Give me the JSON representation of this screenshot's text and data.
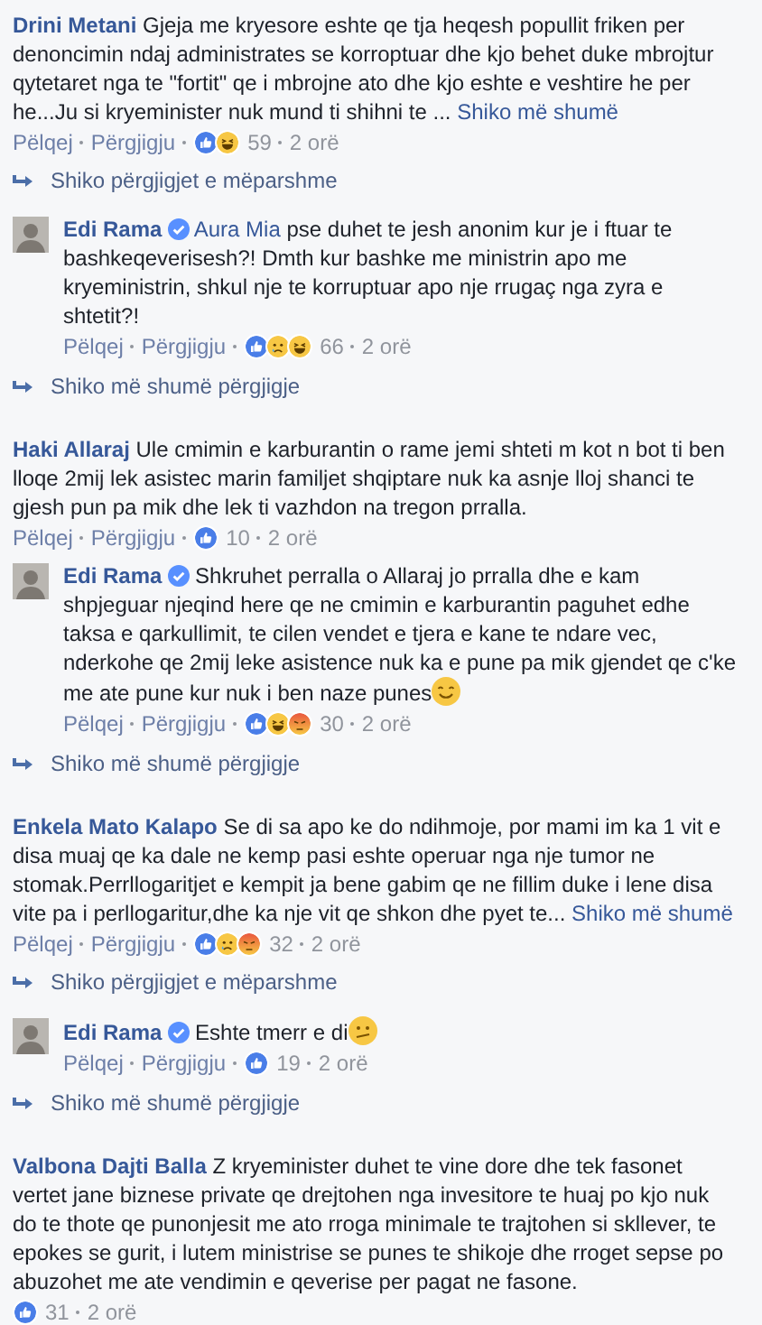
{
  "items": [
    {
      "kind": "comment",
      "author": "Drini Metani",
      "text": "Gjeja me kryesore eshte qe tja heqesh popullit friken per denoncimin ndaj administrates se korroptuar dhe kjo behet duke mbrojtur qytetaret nga te \"fortit\" qe i mbrojne ato dhe kjo eshte e veshtire he per he...Ju si kryeminister nuk mund ti shihni te ...",
      "see_more": "Shiko më shumë",
      "actions": [
        "Pëlqej",
        "Përgjigju"
      ],
      "reactions": [
        {
          "kind": "like"
        },
        {
          "kind": "haha"
        }
      ],
      "count": "59",
      "time": "2 orë"
    },
    {
      "kind": "more_link",
      "label": "Shiko përgjigjet e mëparshme"
    },
    {
      "kind": "reply",
      "author": "Edi Rama",
      "verified": true,
      "mention": "Aura Mia",
      "text": "pse duhet te jesh anonim kur je i ftuar te bashkeqeverisesh?! Dmth kur bashke me ministrin apo me kryeministrin, shkul nje te korruptuar apo nje rrugaç nga zyra e shtetit?!",
      "actions": [
        "Pëlqej",
        "Përgjigju"
      ],
      "reactions": [
        {
          "kind": "like"
        },
        {
          "kind": "sad"
        },
        {
          "kind": "haha"
        }
      ],
      "count": "66",
      "time": "2 orë"
    },
    {
      "kind": "more_link",
      "label": "Shiko më shumë përgjigje"
    },
    {
      "kind": "comment",
      "author": "Haki Allaraj",
      "text": "Ule cmimin e karburantin o rame jemi shteti m kot n bot ti ben lloqe 2mij lek asistec marin familjet shqiptare nuk ka asnje lloj shanci te gjesh pun pa mik dhe lek ti vazhdon na tregon prralla.",
      "actions": [
        "Pëlqej",
        "Përgjigju"
      ],
      "reactions": [
        {
          "kind": "like"
        }
      ],
      "count": "10",
      "time": "2 orë"
    },
    {
      "kind": "reply",
      "author": "Edi Rama",
      "verified": true,
      "text": "Shkruhet perralla o Allaraj jo prralla dhe e kam shpjeguar njeqind here qe ne cmimin e karburantin paguhet edhe taksa e qarkullimit, te cilen vendet e tjera e kane te ndare vec, nderkohe qe 2mij leke asistence nuk ka e pune pa mik gjendet qe c'ke me ate pune kur nuk i ben naze punes",
      "emoji": {
        "kind": "smile"
      },
      "actions": [
        "Pëlqej",
        "Përgjigju"
      ],
      "reactions": [
        {
          "kind": "like"
        },
        {
          "kind": "haha"
        },
        {
          "kind": "angry"
        }
      ],
      "count": "30",
      "time": "2 orë"
    },
    {
      "kind": "more_link",
      "label": "Shiko më shumë përgjigje"
    },
    {
      "kind": "comment",
      "author": "Enkela Mato Kalapo",
      "text": "Se di sa apo ke do ndihmoje, por mami im ka 1 vit e disa muaj qe ka dale ne kemp pasi eshte operuar nga nje tumor ne stomak.Perrllogaritjet e kempit ja bene gabim qe ne fillim duke i lene disa vite pa i perllogaritur,dhe ka nje vit qe shkon dhe pyet te...",
      "see_more": "Shiko më shumë",
      "actions": [
        "Pëlqej",
        "Përgjigju"
      ],
      "reactions": [
        {
          "kind": "like"
        },
        {
          "kind": "sad"
        },
        {
          "kind": "angry"
        }
      ],
      "count": "32",
      "time": "2 orë"
    },
    {
      "kind": "more_link",
      "label": "Shiko përgjigjet e mëparshme"
    },
    {
      "kind": "reply",
      "author": "Edi Rama",
      "verified": true,
      "text": "Eshte tmerr e di",
      "emoji": {
        "kind": "confused"
      },
      "actions": [
        "Pëlqej",
        "Përgjigju"
      ],
      "reactions": [
        {
          "kind": "like"
        }
      ],
      "count": "19",
      "time": "2 orë"
    },
    {
      "kind": "more_link",
      "label": "Shiko më shumë përgjigje"
    },
    {
      "kind": "comment",
      "author": "Valbona Dajti Balla",
      "text": "Z kryeminister duhet te vine dore dhe tek fasonet vertet jane biznese private qe drejtohen nga invesitore te huaj po kjo nuk do te thote qe punonjesit me ato rroga minimale te trajtohen si skllever, te epokes se gurit, i lutem ministrise se punes te shikoje dhe rroget sepse po abuzohet me ate vendimin e qeverise per pagat ne fasone.",
      "reactions": [
        {
          "kind": "like"
        }
      ],
      "count": "31",
      "time": "2 orë"
    }
  ]
}
